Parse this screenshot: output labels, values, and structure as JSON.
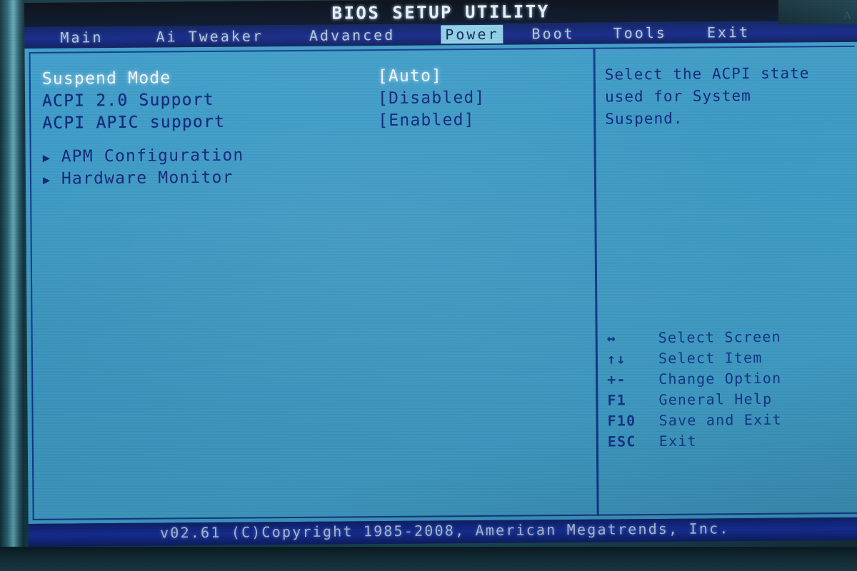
{
  "window": {
    "title": "BIOS SETUP UTILITY",
    "stray_glyph": "A"
  },
  "colors": {
    "screen_bg": "#3f9fcb",
    "text_navy": "#13267e",
    "selected_text": "#f2f8fc",
    "menubar_bg": "#13288a",
    "menu_selected_bg": "#8fd0e6",
    "titlebar_bg": "#061021",
    "frame_border": "#123a8e",
    "footer_bg": "#17309c"
  },
  "menubar": {
    "items": [
      {
        "label": "Main",
        "selected": false
      },
      {
        "label": "Ai Tweaker",
        "selected": false
      },
      {
        "label": "Advanced",
        "selected": false
      },
      {
        "label": "Power",
        "selected": true
      },
      {
        "label": "Boot",
        "selected": false
      },
      {
        "label": "Tools",
        "selected": false
      },
      {
        "label": "Exit",
        "selected": false
      }
    ]
  },
  "settings": {
    "rows": [
      {
        "label": "Suspend Mode",
        "value": "[Auto]",
        "active": true
      },
      {
        "label": "ACPI 2.0 Support",
        "value": "[Disabled]",
        "active": false
      },
      {
        "label": "ACPI APIC support",
        "value": "[Enabled]",
        "active": false
      }
    ],
    "submenus": [
      {
        "arrow": "▶",
        "label": "APM Configuration"
      },
      {
        "arrow": "▶",
        "label": "Hardware Monitor"
      }
    ]
  },
  "help": {
    "lines": [
      "Select the ACPI state",
      "used for System",
      "Suspend."
    ]
  },
  "legend": {
    "rows": [
      {
        "key": "↔",
        "desc": "Select Screen"
      },
      {
        "key": "↑↓",
        "desc": "Select Item"
      },
      {
        "key": "+-",
        "desc": "Change Option"
      },
      {
        "key": "F1",
        "desc": "General Help"
      },
      {
        "key": "F10",
        "desc": "Save and Exit"
      },
      {
        "key": "ESC",
        "desc": "Exit"
      }
    ]
  },
  "footer": {
    "copyright": "v02.61 (C)Copyright 1985-2008, American Megatrends, Inc."
  }
}
